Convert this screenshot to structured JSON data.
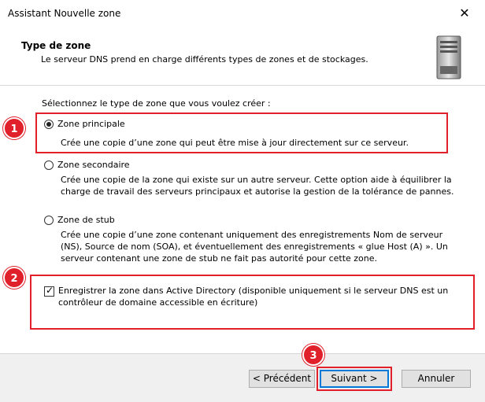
{
  "window": {
    "title": "Assistant Nouvelle zone",
    "close_label": "✕"
  },
  "header": {
    "title": "Type de zone",
    "subtitle": "Le serveur DNS prend en charge différents types de zones et de stockages."
  },
  "body": {
    "prompt": "Sélectionnez le type de zone que vous voulez créer :",
    "options": [
      {
        "label": "Zone principale",
        "selected": true,
        "description": "Crée une copie d’une zone qui peut être mise à jour directement sur ce serveur."
      },
      {
        "label": "Zone secondaire",
        "selected": false,
        "description": "Crée une copie de la zone qui existe sur un autre serveur. Cette option aide à équilibrer la charge de travail des serveurs principaux et autorise la gestion de la tolérance de pannes."
      },
      {
        "label": "Zone de stub",
        "selected": false,
        "description": "Crée une copie d’une zone contenant uniquement des enregistrements Nom de serveur (NS), Source de nom (SOA), et éventuellement des enregistrements « glue Host (A) ». Un serveur contenant une zone de stub ne fait pas autorité pour cette zone."
      }
    ],
    "ad_checkbox": {
      "checked": true,
      "label": "Enregistrer la zone dans Active Directory (disponible uniquement si le serveur DNS est un contrôleur de domaine accessible en écriture)"
    }
  },
  "annotations": {
    "badge1": "1",
    "badge2": "2",
    "badge3": "3",
    "color": "#e0202a"
  },
  "footer": {
    "back_label": "< Précédent",
    "next_label": "Suivant >",
    "cancel_label": "Annuler"
  }
}
